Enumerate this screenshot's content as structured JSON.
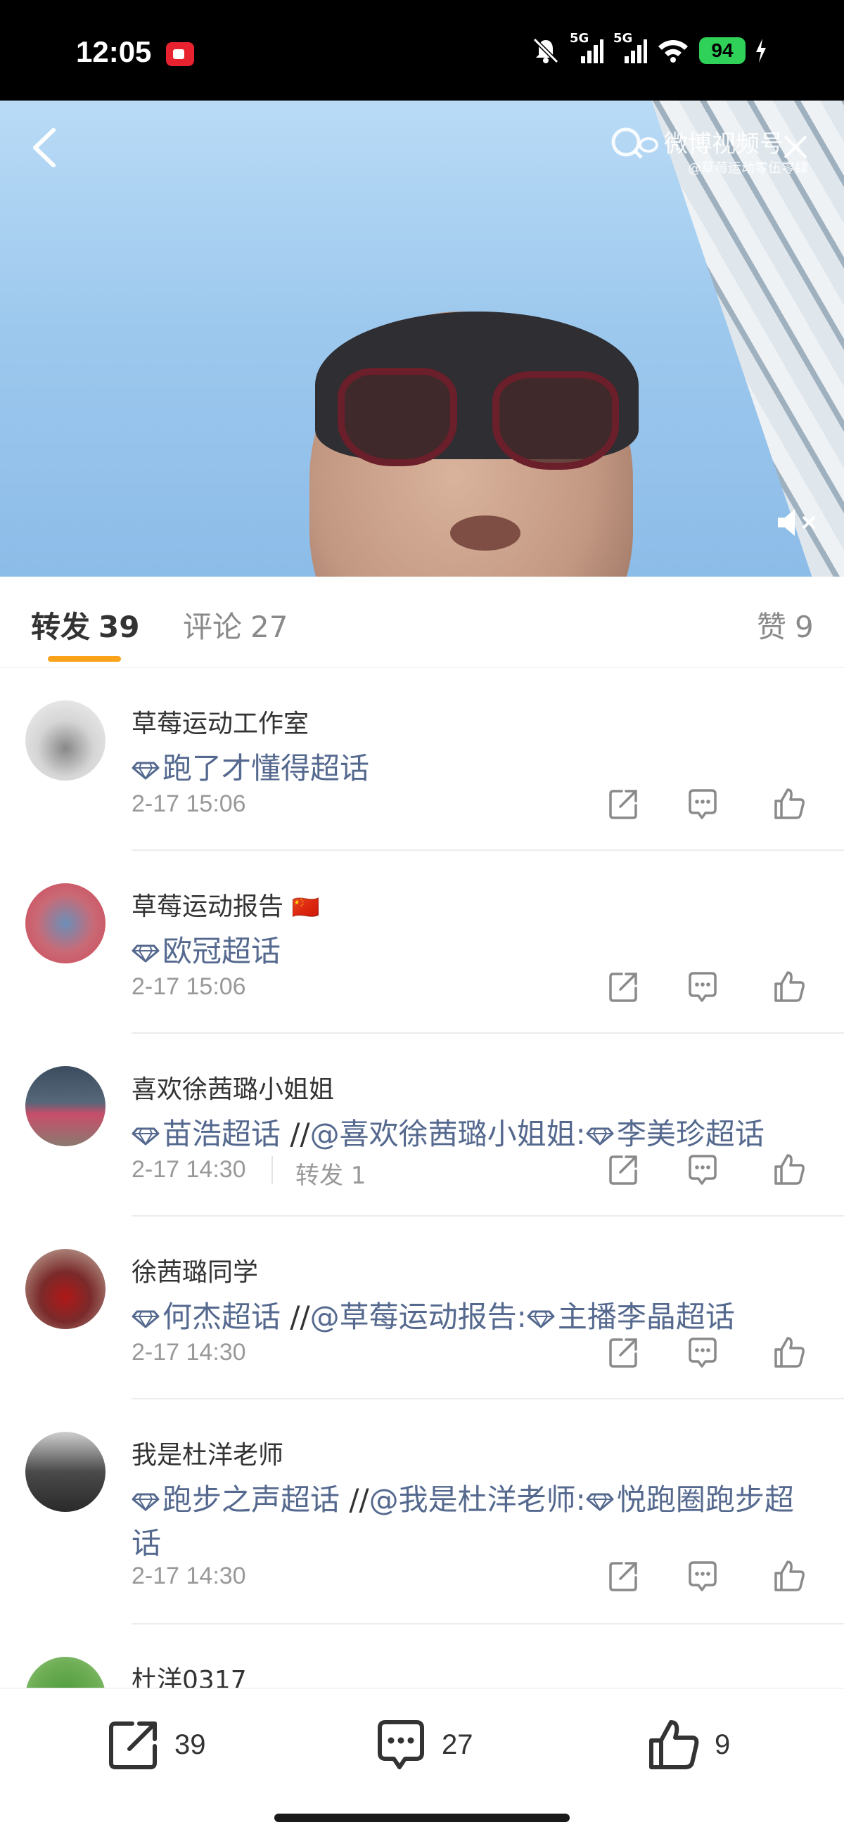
{
  "status": {
    "time": "12:05",
    "network_1": "5G",
    "network_2": "5G",
    "battery": "94"
  },
  "video": {
    "watermark_title": "微博视频号",
    "watermark_sub": "@草莓运动零伍零肆"
  },
  "tabs": {
    "repost_label": "转发",
    "repost_count": "39",
    "comment_label": "评论",
    "comment_count": "27",
    "like_label": "赞",
    "like_count": "9"
  },
  "reposts": [
    {
      "name": "草莓运动工作室",
      "segments": [
        {
          "text": "跑了才懂得超话",
          "type": "super"
        }
      ],
      "time": "2-17 15:06"
    },
    {
      "name": "草莓运动报告",
      "flag": "🇨🇳",
      "segments": [
        {
          "text": "欧冠超话",
          "type": "super"
        }
      ],
      "time": "2-17 15:06"
    },
    {
      "name": "喜欢徐茜璐小姐姐",
      "segments": [
        {
          "text": "苗浩超话",
          "type": "super"
        },
        {
          "text": " //",
          "type": "plain"
        },
        {
          "text": "@喜欢徐茜璐小姐姐:",
          "type": "link"
        },
        {
          "text": "李美珍超话",
          "type": "super"
        }
      ],
      "time": "2-17 14:30",
      "repost_count": "转发 1"
    },
    {
      "name": "徐茜璐同学",
      "segments": [
        {
          "text": "何杰超话",
          "type": "super"
        },
        {
          "text": " //",
          "type": "plain"
        },
        {
          "text": "@草莓运动报告:",
          "type": "link"
        },
        {
          "text": "主播李晶超话",
          "type": "super"
        }
      ],
      "time": "2-17 14:30"
    },
    {
      "name": "我是杜洋老师",
      "segments": [
        {
          "text": "跑步之声超话",
          "type": "super"
        },
        {
          "text": " //",
          "type": "plain"
        },
        {
          "text": "@我是杜洋老师:",
          "type": "link"
        },
        {
          "text": "悦跑圈跑步超话",
          "type": "super"
        }
      ],
      "time": "2-17 14:30"
    },
    {
      "name": "杜洋0317",
      "segments": [],
      "time": ""
    }
  ],
  "bottom": {
    "repost_count": "39",
    "comment_count": "27",
    "like_count": "9"
  },
  "colors": {
    "accent": "#f9a21a",
    "link": "#55698f",
    "battery": "#2fd158"
  }
}
